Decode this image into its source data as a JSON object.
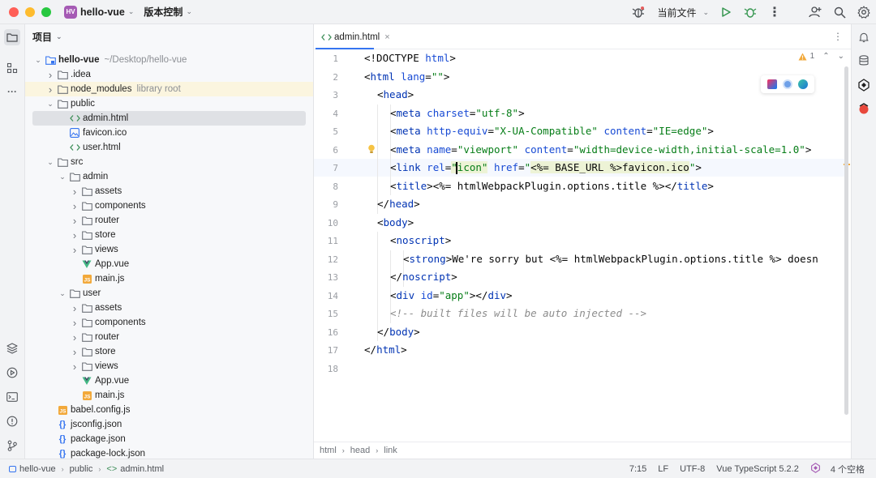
{
  "titlebar": {
    "project_badge": "HV",
    "project_name": "hello-vue",
    "vcs_label": "版本控制",
    "run_config": "当前文件"
  },
  "project_panel": {
    "title": "项目",
    "tree": [
      {
        "depth": 0,
        "expanded": true,
        "icon": "module-folder-icon",
        "label": "hello-vue",
        "hint": "~/Desktop/hello-vue",
        "bold": true
      },
      {
        "depth": 1,
        "expanded": false,
        "icon": "folder-icon",
        "label": ".idea"
      },
      {
        "depth": 1,
        "expanded": false,
        "icon": "folder-icon",
        "label": "node_modules",
        "hint": "library root",
        "highlight": true
      },
      {
        "depth": 1,
        "expanded": true,
        "icon": "folder-icon",
        "label": "public"
      },
      {
        "depth": 2,
        "icon": "html-file-icon",
        "label": "admin.html",
        "selected": true
      },
      {
        "depth": 2,
        "icon": "image-file-icon",
        "label": "favicon.ico"
      },
      {
        "depth": 2,
        "icon": "html-file-icon",
        "label": "user.html"
      },
      {
        "depth": 1,
        "expanded": true,
        "icon": "folder-icon",
        "label": "src"
      },
      {
        "depth": 2,
        "expanded": true,
        "icon": "folder-icon",
        "label": "admin"
      },
      {
        "depth": 3,
        "expanded": false,
        "icon": "folder-icon",
        "label": "assets"
      },
      {
        "depth": 3,
        "expanded": false,
        "icon": "folder-icon",
        "label": "components"
      },
      {
        "depth": 3,
        "expanded": false,
        "icon": "folder-icon",
        "label": "router"
      },
      {
        "depth": 3,
        "expanded": false,
        "icon": "folder-icon",
        "label": "store"
      },
      {
        "depth": 3,
        "expanded": false,
        "icon": "folder-icon",
        "label": "views"
      },
      {
        "depth": 3,
        "icon": "vue-file-icon",
        "label": "App.vue"
      },
      {
        "depth": 3,
        "icon": "js-file-icon",
        "label": "main.js"
      },
      {
        "depth": 2,
        "expanded": true,
        "icon": "folder-icon",
        "label": "user"
      },
      {
        "depth": 3,
        "expanded": false,
        "icon": "folder-icon",
        "label": "assets"
      },
      {
        "depth": 3,
        "expanded": false,
        "icon": "folder-icon",
        "label": "components"
      },
      {
        "depth": 3,
        "expanded": false,
        "icon": "folder-icon",
        "label": "router"
      },
      {
        "depth": 3,
        "expanded": false,
        "icon": "folder-icon",
        "label": "store"
      },
      {
        "depth": 3,
        "expanded": false,
        "icon": "folder-icon",
        "label": "views"
      },
      {
        "depth": 3,
        "icon": "vue-file-icon",
        "label": "App.vue"
      },
      {
        "depth": 3,
        "icon": "js-file-icon",
        "label": "main.js"
      },
      {
        "depth": 1,
        "icon": "js-file-icon",
        "label": "babel.config.js"
      },
      {
        "depth": 1,
        "icon": "json-file-icon",
        "label": "jsconfig.json"
      },
      {
        "depth": 1,
        "icon": "json-file-icon",
        "label": "package.json"
      },
      {
        "depth": 1,
        "icon": "json-file-icon",
        "label": "package-lock.json"
      }
    ]
  },
  "editor": {
    "tab_label": "admin.html",
    "inspection_count": "1",
    "line_numbers": [
      "1",
      "2",
      "3",
      "4",
      "5",
      "6",
      "7",
      "8",
      "9",
      "10",
      "11",
      "12",
      "13",
      "14",
      "15",
      "16",
      "17",
      "18"
    ],
    "code": [
      {
        "indent": 0,
        "parts": [
          [
            "p",
            "<!DOCTYPE "
          ],
          [
            "attr",
            "html"
          ],
          [
            "p",
            ">"
          ]
        ]
      },
      {
        "indent": 0,
        "parts": [
          [
            "p",
            "<"
          ],
          [
            "tag",
            "html"
          ],
          [
            "p",
            " "
          ],
          [
            "attr",
            "lang"
          ],
          [
            "p",
            "="
          ],
          [
            "str",
            "\"\""
          ],
          [
            "p",
            ">"
          ]
        ]
      },
      {
        "indent": 1,
        "parts": [
          [
            "p",
            "<"
          ],
          [
            "tag",
            "head"
          ],
          [
            "p",
            ">"
          ]
        ]
      },
      {
        "indent": 2,
        "parts": [
          [
            "p",
            "<"
          ],
          [
            "tag",
            "meta"
          ],
          [
            "p",
            " "
          ],
          [
            "attr",
            "charset"
          ],
          [
            "p",
            "="
          ],
          [
            "str",
            "\"utf-8\""
          ],
          [
            "p",
            ">"
          ]
        ]
      },
      {
        "indent": 2,
        "parts": [
          [
            "p",
            "<"
          ],
          [
            "tag",
            "meta"
          ],
          [
            "p",
            " "
          ],
          [
            "attr",
            "http-equiv"
          ],
          [
            "p",
            "="
          ],
          [
            "str",
            "\"X-UA-Compatible\""
          ],
          [
            "p",
            " "
          ],
          [
            "attr",
            "content"
          ],
          [
            "p",
            "="
          ],
          [
            "str",
            "\"IE=edge\""
          ],
          [
            "p",
            ">"
          ]
        ]
      },
      {
        "indent": 2,
        "parts": [
          [
            "p",
            "<"
          ],
          [
            "tag",
            "meta"
          ],
          [
            "p",
            " "
          ],
          [
            "attr",
            "name"
          ],
          [
            "p",
            "="
          ],
          [
            "str",
            "\"viewport\""
          ],
          [
            "p",
            " "
          ],
          [
            "attr",
            "content"
          ],
          [
            "p",
            "="
          ],
          [
            "str",
            "\"width=device-width,initial-scale=1.0\""
          ],
          [
            "p",
            ">"
          ]
        ]
      },
      {
        "indent": 2,
        "parts": [
          [
            "p",
            "<"
          ],
          [
            "tag",
            "link"
          ],
          [
            "p",
            " "
          ],
          [
            "attr",
            "rel"
          ],
          [
            "p",
            "="
          ],
          [
            "strhl",
            "\"icon\""
          ],
          [
            "p",
            " "
          ],
          [
            "attr",
            "href"
          ],
          [
            "p",
            "="
          ],
          [
            "str",
            "\""
          ],
          [
            "tplhl",
            "<%= BASE_URL %>favicon.ico"
          ],
          [
            "str",
            "\""
          ],
          [
            "p",
            ">"
          ]
        ]
      },
      {
        "indent": 2,
        "parts": [
          [
            "p",
            "<"
          ],
          [
            "tag",
            "title"
          ],
          [
            "p",
            ">"
          ],
          [
            "p",
            "<%= htmlWebpackPlugin.options.title %>"
          ],
          [
            "p",
            "</"
          ],
          [
            "tag",
            "title"
          ],
          [
            "p",
            ">"
          ]
        ]
      },
      {
        "indent": 1,
        "parts": [
          [
            "p",
            "</"
          ],
          [
            "tag",
            "head"
          ],
          [
            "p",
            ">"
          ]
        ]
      },
      {
        "indent": 1,
        "parts": [
          [
            "p",
            "<"
          ],
          [
            "tag",
            "body"
          ],
          [
            "p",
            ">"
          ]
        ]
      },
      {
        "indent": 2,
        "parts": [
          [
            "p",
            "<"
          ],
          [
            "tag",
            "noscript"
          ],
          [
            "p",
            ">"
          ]
        ]
      },
      {
        "indent": 3,
        "parts": [
          [
            "p",
            "<"
          ],
          [
            "tag",
            "strong"
          ],
          [
            "p",
            ">"
          ],
          [
            "p",
            "We're sorry but <%= htmlWebpackPlugin.options.title %> doesn"
          ]
        ]
      },
      {
        "indent": 2,
        "parts": [
          [
            "p",
            "</"
          ],
          [
            "tag",
            "noscript"
          ],
          [
            "p",
            ">"
          ]
        ]
      },
      {
        "indent": 2,
        "parts": [
          [
            "p",
            "<"
          ],
          [
            "tag",
            "div"
          ],
          [
            "p",
            " "
          ],
          [
            "attr",
            "id"
          ],
          [
            "p",
            "="
          ],
          [
            "str",
            "\"app\""
          ],
          [
            "p",
            "></"
          ],
          [
            "tag",
            "div"
          ],
          [
            "p",
            ">"
          ]
        ]
      },
      {
        "indent": 2,
        "parts": [
          [
            "com",
            "<!-- built files will be auto injected -->"
          ]
        ]
      },
      {
        "indent": 1,
        "parts": [
          [
            "p",
            "</"
          ],
          [
            "tag",
            "body"
          ],
          [
            "p",
            ">"
          ]
        ]
      },
      {
        "indent": 0,
        "parts": [
          [
            "p",
            "</"
          ],
          [
            "tag",
            "html"
          ],
          [
            "p",
            ">"
          ]
        ]
      },
      {
        "indent": 0,
        "parts": []
      }
    ],
    "breadcrumbs": [
      "html",
      "head",
      "link"
    ]
  },
  "statusbar": {
    "path": [
      "hello-vue",
      "public",
      "admin.html"
    ],
    "caret": "7:15",
    "line_sep": "LF",
    "encoding": "UTF-8",
    "language": "Vue TypeScript 5.2.2",
    "indent": "4 个空格"
  },
  "colors": {
    "accent": "#3574f0",
    "tag": "#0033b3",
    "attr": "#174ad4",
    "string": "#067d17",
    "comment": "#8c8c8c"
  }
}
